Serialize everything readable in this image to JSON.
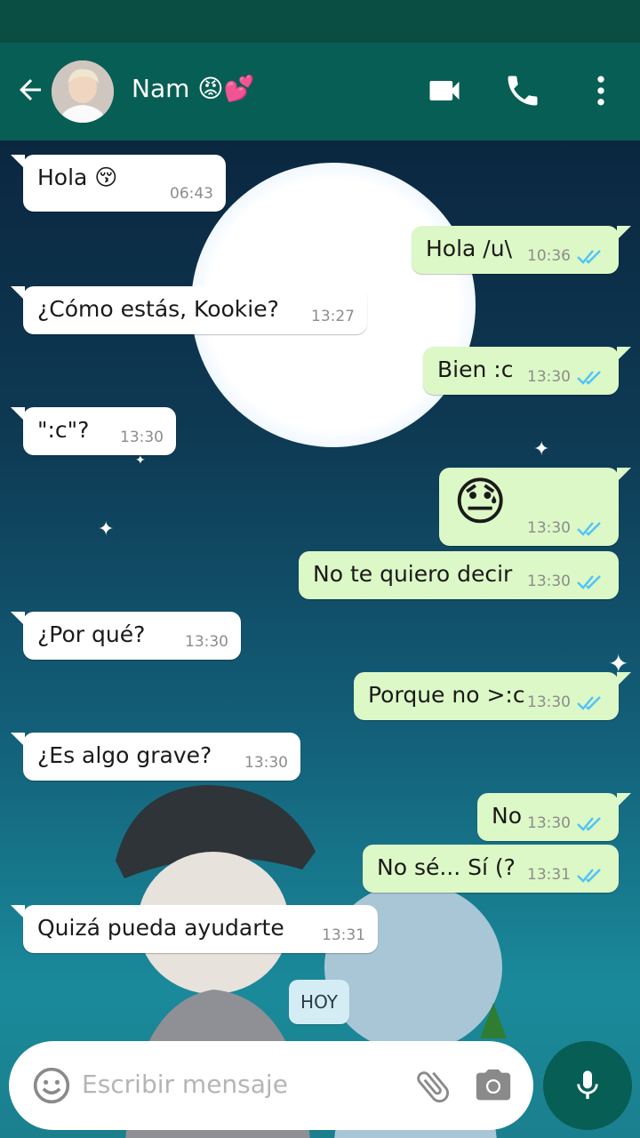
{
  "header": {
    "contact_name": "Nam 😡💕",
    "back_icon": "arrow-back-icon",
    "video_icon": "videocam-icon",
    "call_icon": "phone-icon",
    "menu_icon": "more-vert-icon"
  },
  "colors": {
    "appbar": "#075e54",
    "statusbar": "#0a4d42",
    "incoming_bubble": "#ffffff",
    "outgoing_bubble": "#dcf8c6",
    "read_ticks": "#4fc3f7"
  },
  "messages": [
    {
      "direction": "in",
      "text": "Hola 😚",
      "time": "06:43"
    },
    {
      "direction": "out",
      "text": "Hola /u\\",
      "time": "10:36",
      "status": "read"
    },
    {
      "direction": "in",
      "text": "¿Cómo estás, Kookie?",
      "time": "13:27"
    },
    {
      "direction": "out",
      "text": "Bien :c",
      "time": "13:30",
      "status": "read"
    },
    {
      "direction": "in",
      "text": "\":c\"?",
      "time": "13:30"
    },
    {
      "direction": "out",
      "text": "😓",
      "time": "13:30",
      "status": "read"
    },
    {
      "direction": "out",
      "text": "No te quiero decir",
      "time": "13:30",
      "status": "read"
    },
    {
      "direction": "in",
      "text": "¿Por qué?",
      "time": "13:30"
    },
    {
      "direction": "out",
      "text": "Porque no >:c",
      "time": "13:30",
      "status": "read"
    },
    {
      "direction": "in",
      "text": "¿Es algo grave?",
      "time": "13:30"
    },
    {
      "direction": "out",
      "text": "No",
      "time": "13:30",
      "status": "read"
    },
    {
      "direction": "out",
      "text": "No sé... Sí (?",
      "time": "13:31",
      "status": "read"
    },
    {
      "direction": "in",
      "text": "Quizá pueda ayudarte",
      "time": "13:31"
    }
  ],
  "date_chip": "HOY",
  "composer": {
    "placeholder": "Escribir mensaje",
    "emoji_icon": "emoji-icon",
    "attach_icon": "paperclip-icon",
    "camera_icon": "camera-icon",
    "mic_icon": "mic-icon"
  }
}
